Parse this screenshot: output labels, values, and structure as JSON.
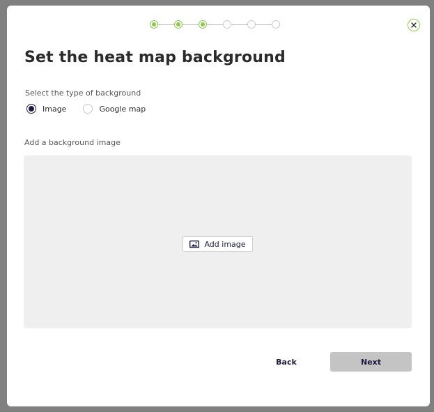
{
  "modal": {
    "title": "Set the heat map background",
    "stepper": {
      "total_steps": 6,
      "completed_steps": 3,
      "accent_color": "#8cc84b"
    },
    "close_icon": "close-icon"
  },
  "background_type": {
    "label": "Select the type of background",
    "options": [
      {
        "label": "Image",
        "checked": true
      },
      {
        "label": "Google map",
        "checked": false
      }
    ]
  },
  "background_image": {
    "label": "Add a background image",
    "add_button_label": "Add image",
    "add_button_icon": "image-icon"
  },
  "footer": {
    "back_label": "Back",
    "next_label": "Next"
  },
  "colors": {
    "primary": "#1c1a40",
    "accent": "#8cc84b",
    "disabled_button": "#c4c4c4",
    "dropzone": "#efefef"
  }
}
